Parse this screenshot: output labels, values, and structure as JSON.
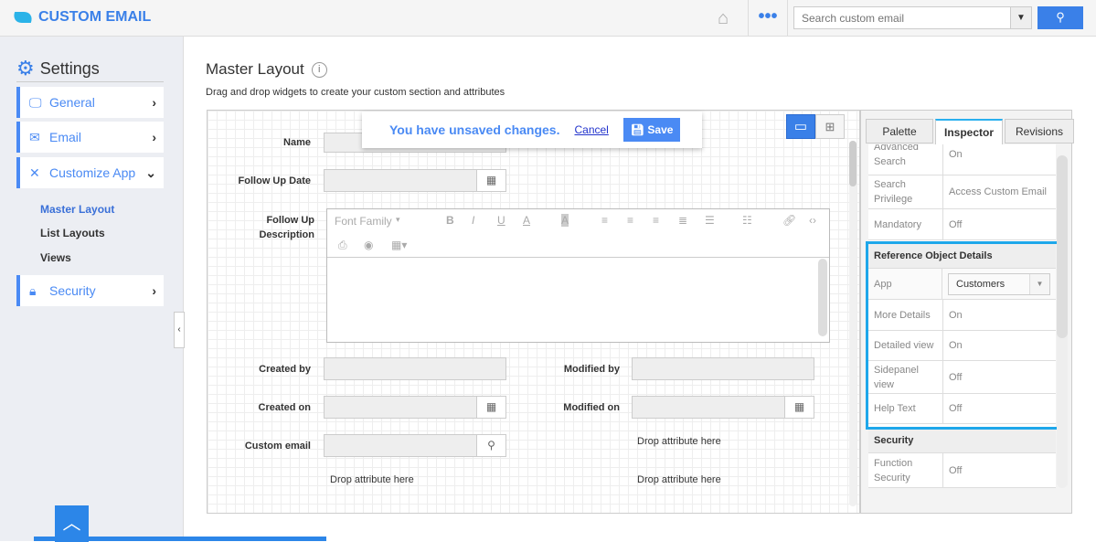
{
  "header": {
    "app_title": "CUSTOM EMAIL",
    "search_placeholder": "Search custom email",
    "icons": [
      "home-icon",
      "more-icon",
      "search-icon"
    ]
  },
  "sidebar": {
    "title": "Settings",
    "items": [
      {
        "label": "General",
        "icon": "monitor-icon"
      },
      {
        "label": "Email",
        "icon": "envelope-icon"
      },
      {
        "label": "Customize App",
        "icon": "tools-icon",
        "expanded": true
      },
      {
        "label": "Security",
        "icon": "lock-icon"
      }
    ],
    "subitems": [
      {
        "label": "Master Layout",
        "active": true
      },
      {
        "label": "List Layouts"
      },
      {
        "label": "Views"
      }
    ]
  },
  "main": {
    "title": "Master Layout",
    "subtitle": "Drag and drop widgets to create your custom section and attributes",
    "unsaved": {
      "message": "You have unsaved changes.",
      "cancel": "Cancel",
      "save": "Save"
    },
    "form": {
      "name": "Name",
      "follow_up_date": "Follow Up Date",
      "follow_up_description": "Follow Up Description",
      "created_by": "Created by",
      "modified_by": "Modified by",
      "created_on": "Created on",
      "modified_on": "Modified on",
      "custom_email": "Custom email",
      "drop": "Drop attribute here"
    },
    "editor": {
      "font_family": "Font Family"
    }
  },
  "panel": {
    "tabs": [
      "Palette",
      "Inspector",
      "Revisions"
    ],
    "active_tab": "Inspector",
    "rows_top": [
      {
        "k": "Advanced Search",
        "v": "On"
      },
      {
        "k": "Search Privilege",
        "v": "Access Custom Email"
      },
      {
        "k": "Mandatory",
        "v": "Off"
      }
    ],
    "ref_section": "Reference Object Details",
    "app": {
      "k": "App",
      "v": "Customers"
    },
    "ref_rows": [
      {
        "k": "More Details",
        "v": "On"
      },
      {
        "k": "Detailed view",
        "v": "On"
      },
      {
        "k": "Sidepanel view",
        "v": "Off"
      },
      {
        "k": "Help Text",
        "v": "Off"
      }
    ],
    "security_section": "Security",
    "security_rows": [
      {
        "k": "Function Security",
        "v": "Off"
      }
    ]
  },
  "colors": {
    "accent": "#3a80e8",
    "highlight": "#1ea7ea"
  }
}
